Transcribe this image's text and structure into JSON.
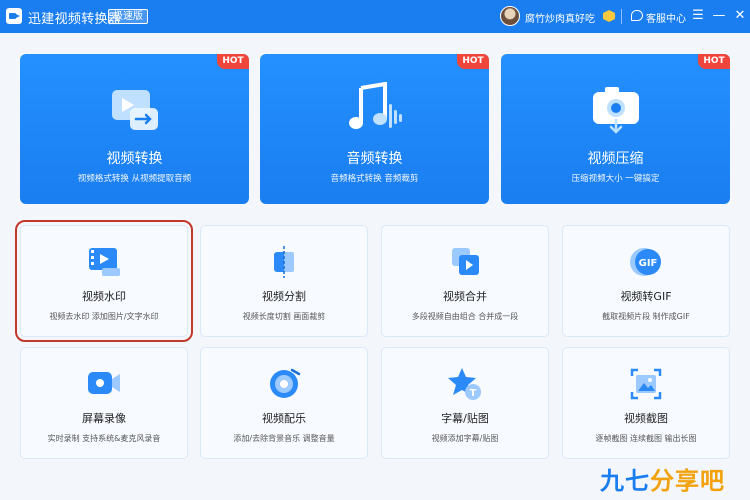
{
  "titlebar": {
    "app_name": "迅建视频转换器",
    "edition": "极速版",
    "username": "腐竹炒肉真好吃",
    "service_label": "客服中心",
    "menu_glyph": "☰",
    "minimize_glyph": "—",
    "close_glyph": "✕"
  },
  "hot_label": "HOT",
  "features": [
    {
      "icon": "video-convert-icon",
      "title": "视频转换",
      "subtitle": "视频格式转换 从视频提取音频"
    },
    {
      "icon": "music-note-icon",
      "title": "音频转换",
      "subtitle": "音频格式转换 音频裁剪"
    },
    {
      "icon": "video-compress-icon",
      "title": "视频压缩",
      "subtitle": "压缩视频大小 一键搞定"
    }
  ],
  "tools": [
    {
      "icon": "film-icon",
      "title": "视频水印",
      "subtitle": "视频去水印 添加图片/文字水印"
    },
    {
      "icon": "split-icon",
      "title": "视频分割",
      "subtitle": "视频长度切割 画面裁剪"
    },
    {
      "icon": "merge-icon",
      "title": "视频合并",
      "subtitle": "多段视频自由组合 合并成一段"
    },
    {
      "icon": "gif-icon",
      "title": "视频转GIF",
      "subtitle": "截取视频片段 制作成GIF",
      "icon_text": "GIF"
    },
    {
      "icon": "camera-record-icon",
      "title": "屏幕录像",
      "subtitle": "实时录制 支持系统&麦克风录音"
    },
    {
      "icon": "music-disc-icon",
      "title": "视频配乐",
      "subtitle": "添加/去除背景音乐 调整音量"
    },
    {
      "icon": "subtitle-star-icon",
      "title": "字幕/贴图",
      "subtitle": "视频添加字幕/贴图",
      "icon_text": "T"
    },
    {
      "icon": "screenshot-icon",
      "title": "视频截图",
      "subtitle": "逐帧截图 连续截图 输出长图"
    }
  ],
  "watermark": {
    "part1": "九七",
    "part2": "分享吧"
  },
  "colors": {
    "brand": "#1a7ef0",
    "hot": "#f0453a",
    "highlight": "#c0392b"
  }
}
